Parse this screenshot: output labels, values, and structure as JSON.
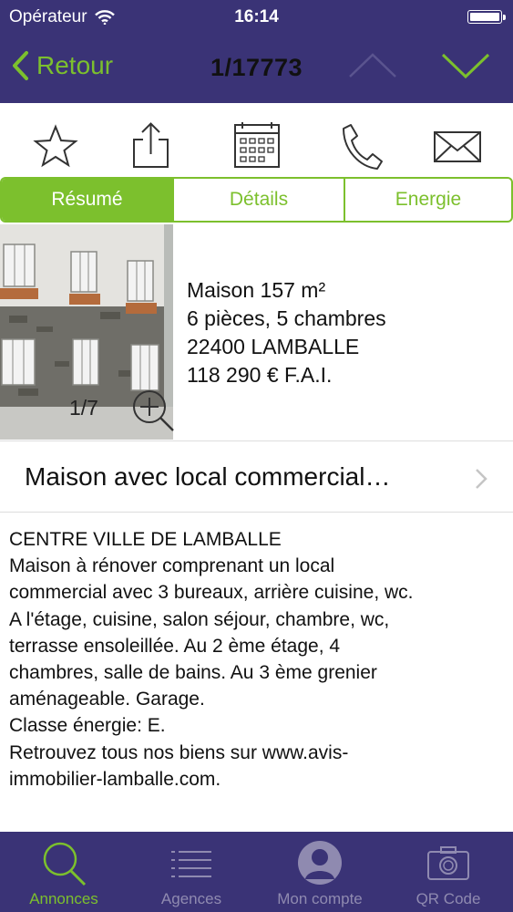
{
  "status_bar": {
    "carrier": "Opérateur",
    "time": "16:14"
  },
  "nav": {
    "back_label": "Retour",
    "counter": "1/17773"
  },
  "actions": [
    "star-icon",
    "share-icon",
    "calendar-icon",
    "phone-icon",
    "mail-icon"
  ],
  "segments": [
    {
      "label": "Résumé",
      "active": true
    },
    {
      "label": "Détails",
      "active": false
    },
    {
      "label": "Energie",
      "active": false
    }
  ],
  "photo": {
    "counter": "1/7"
  },
  "summary": {
    "line1": "Maison 157 m²",
    "line2": "6 pièces, 5 chambres",
    "line3": "22400 LAMBALLE",
    "line4": "118 290 € F.A.I."
  },
  "listing_title": "Maison avec local commercial…",
  "description": [
    "CENTRE VILLE DE LAMBALLE",
    "Maison à rénover comprenant un local",
    "commercial avec 3 bureaux, arrière cuisine, wc.",
    "A l'étage, cuisine, salon séjour, chambre, wc,",
    "terrasse ensoleillée. Au 2 ème étage, 4",
    "chambres, salle de bains. Au 3 ème grenier",
    "aménageable. Garage.",
    "Classe énergie: E.",
    "Retrouvez tous nos biens sur www.avis-",
    "immobilier-lamballe.com."
  ],
  "tabbar": [
    {
      "label": "Annonces",
      "active": true
    },
    {
      "label": "Agences",
      "active": false
    },
    {
      "label": "Mon compte",
      "active": false
    },
    {
      "label": "QR Code",
      "active": false
    }
  ],
  "colors": {
    "nav_bg": "#3a3376",
    "accent": "#7cc02d"
  }
}
